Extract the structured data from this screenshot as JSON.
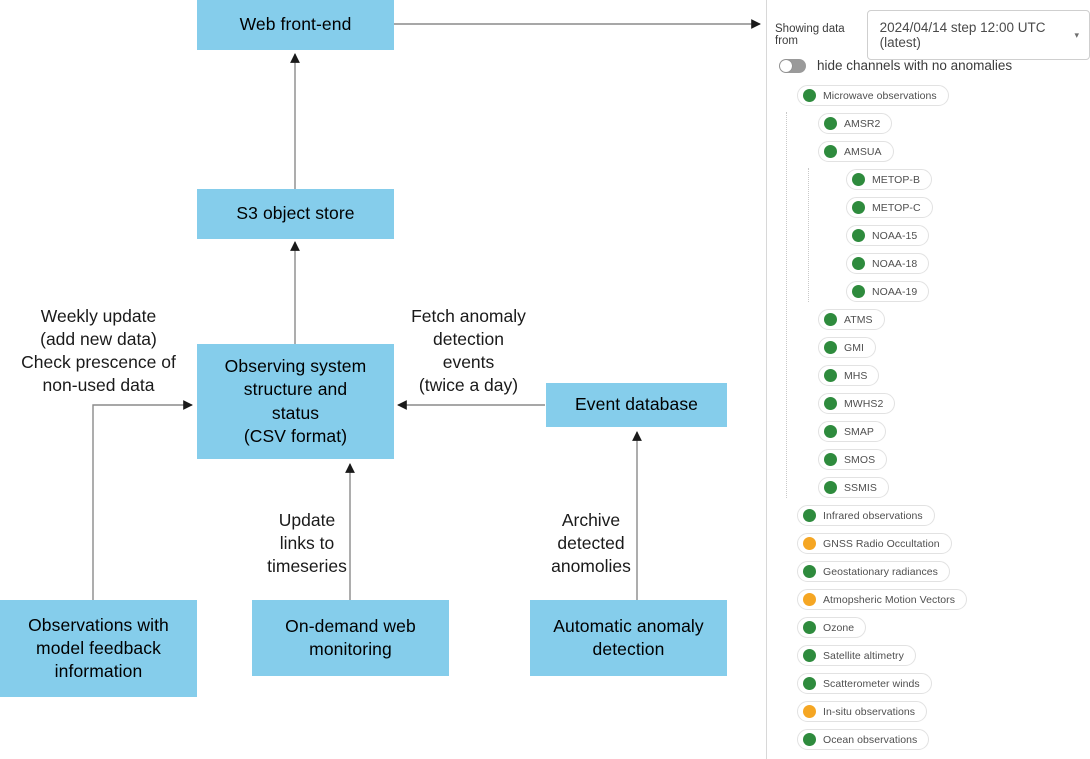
{
  "colors": {
    "node_fill": "#85cdeb",
    "edge_stroke": "#8a8a8a",
    "status_ok": "#2e8b3d",
    "status_warn": "#f5a623"
  },
  "diagram": {
    "nodes": [
      {
        "id": "web-front-end",
        "label": "Web front-end"
      },
      {
        "id": "s3-object-store",
        "label": "S3 object store"
      },
      {
        "id": "observing-system",
        "label": "Observing system\nstructure and\nstatus\n(CSV format)"
      },
      {
        "id": "event-database",
        "label": "Event database"
      },
      {
        "id": "observations-feedback",
        "label": "Observations with\nmodel feedback\ninformation"
      },
      {
        "id": "on-demand-monitoring",
        "label": "On-demand web\nmonitoring"
      },
      {
        "id": "automatic-detection",
        "label": "Automatic anomaly\ndetection"
      }
    ],
    "edge_labels": [
      {
        "id": "weekly-update",
        "label": "Weekly update\n(add new data)\nCheck prescence of\nnon-used data"
      },
      {
        "id": "fetch-anomaly",
        "label": "Fetch anomaly\ndetection\nevents\n(twice a day)"
      },
      {
        "id": "update-links",
        "label": "Update\nlinks to\ntimeseries"
      },
      {
        "id": "archive-anomalies",
        "label": "Archive\ndetected\nanomolies"
      }
    ]
  },
  "panel": {
    "showing_label": "Showing data from",
    "date_value": "2024/04/14 step 12:00 UTC (latest)",
    "caret": "▾",
    "toggle_label": "hide channels with no anomalies",
    "toggle_on": false,
    "tree": [
      {
        "label": "Microwave observations",
        "status": "ok",
        "level": 0
      },
      {
        "label": "AMSR2",
        "status": "ok",
        "level": 1
      },
      {
        "label": "AMSUA",
        "status": "ok",
        "level": 1
      },
      {
        "label": "METOP-B",
        "status": "ok",
        "level": 2
      },
      {
        "label": "METOP-C",
        "status": "ok",
        "level": 2
      },
      {
        "label": "NOAA-15",
        "status": "ok",
        "level": 2
      },
      {
        "label": "NOAA-18",
        "status": "ok",
        "level": 2
      },
      {
        "label": "NOAA-19",
        "status": "ok",
        "level": 2
      },
      {
        "label": "ATMS",
        "status": "ok",
        "level": 1
      },
      {
        "label": "GMI",
        "status": "ok",
        "level": 1
      },
      {
        "label": "MHS",
        "status": "ok",
        "level": 1
      },
      {
        "label": "MWHS2",
        "status": "ok",
        "level": 1
      },
      {
        "label": "SMAP",
        "status": "ok",
        "level": 1
      },
      {
        "label": "SMOS",
        "status": "ok",
        "level": 1
      },
      {
        "label": "SSMIS",
        "status": "ok",
        "level": 1
      },
      {
        "label": "Infrared observations",
        "status": "ok",
        "level": 0
      },
      {
        "label": "GNSS Radio Occultation",
        "status": "warn",
        "level": 0
      },
      {
        "label": "Geostationary radiances",
        "status": "ok",
        "level": 0
      },
      {
        "label": "Atmopsheric Motion Vectors",
        "status": "warn",
        "level": 0
      },
      {
        "label": "Ozone",
        "status": "ok",
        "level": 0
      },
      {
        "label": "Satellite altimetry",
        "status": "ok",
        "level": 0
      },
      {
        "label": "Scatterometer winds",
        "status": "ok",
        "level": 0
      },
      {
        "label": "In-situ observations",
        "status": "warn",
        "level": 0
      },
      {
        "label": "Ocean observations",
        "status": "ok",
        "level": 0
      }
    ]
  }
}
